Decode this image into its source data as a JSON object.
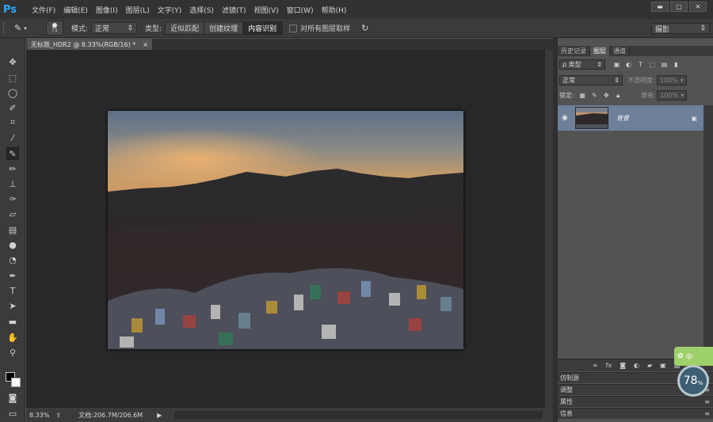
{
  "app": {
    "logo": "Ps",
    "menus": [
      "文件(F)",
      "编辑(E)",
      "图像(I)",
      "图层(L)",
      "文字(Y)",
      "选择(S)",
      "滤镜(T)",
      "视图(V)",
      "窗口(W)",
      "帮助(H)"
    ],
    "window_controls": [
      "▬",
      "□",
      "✕"
    ]
  },
  "options": {
    "brush_size": "71",
    "mode_label": "模式:",
    "mode_value": "正常",
    "type_label": "类型:",
    "type_options": [
      "近似匹配",
      "创建纹理",
      "内容识别"
    ],
    "type_selected": 2,
    "sample_all_label": "对所有图层取样",
    "workspace": "摄影"
  },
  "toolbar": {
    "tools": [
      "move-tool",
      "marquee-tool",
      "lasso-tool",
      "quick-select-tool",
      "crop-tool",
      "eyedropper-tool",
      "spot-healing-tool",
      "brush-tool",
      "clone-stamp-tool",
      "history-brush-tool",
      "eraser-tool",
      "gradient-tool",
      "blur-tool",
      "dodge-tool",
      "pen-tool",
      "type-tool",
      "path-select-tool",
      "rectangle-tool",
      "hand-tool",
      "zoom-tool"
    ],
    "active_tool": "spot-healing-tool",
    "foreground_color": "#000000",
    "background_color": "#ffffff"
  },
  "document": {
    "tab_title": "无标题_HDR2 @ 8.33%(RGB/16) *",
    "zoom": "8.33%",
    "doc_info": "文档:206.7M/206.6M"
  },
  "panels": {
    "tabs": [
      "历史记录",
      "图层",
      "通道"
    ],
    "active_tab": "图层",
    "filter_kind": "ρ 类型",
    "blend_mode": "正常",
    "opacity_label": "不透明度:",
    "opacity_value": "100%",
    "lock_label": "锁定:",
    "fill_label": "填充:",
    "fill_value": "100%",
    "layer_name": "背景",
    "footer_icons": [
      "link-icon",
      "fx-icon",
      "mask-icon",
      "adjustment-icon",
      "folder-icon",
      "new-layer-icon",
      "trash-icon"
    ],
    "collapsed": [
      "仿制源",
      "调整",
      "属性",
      "信息"
    ]
  },
  "overlay": {
    "flag_text": "中",
    "gauge_value": "78",
    "gauge_unit": "%"
  },
  "colors": {
    "accent": "#2fa8ff",
    "layer_selected": "#6d7f99",
    "widget_green": "#9fd16b"
  }
}
